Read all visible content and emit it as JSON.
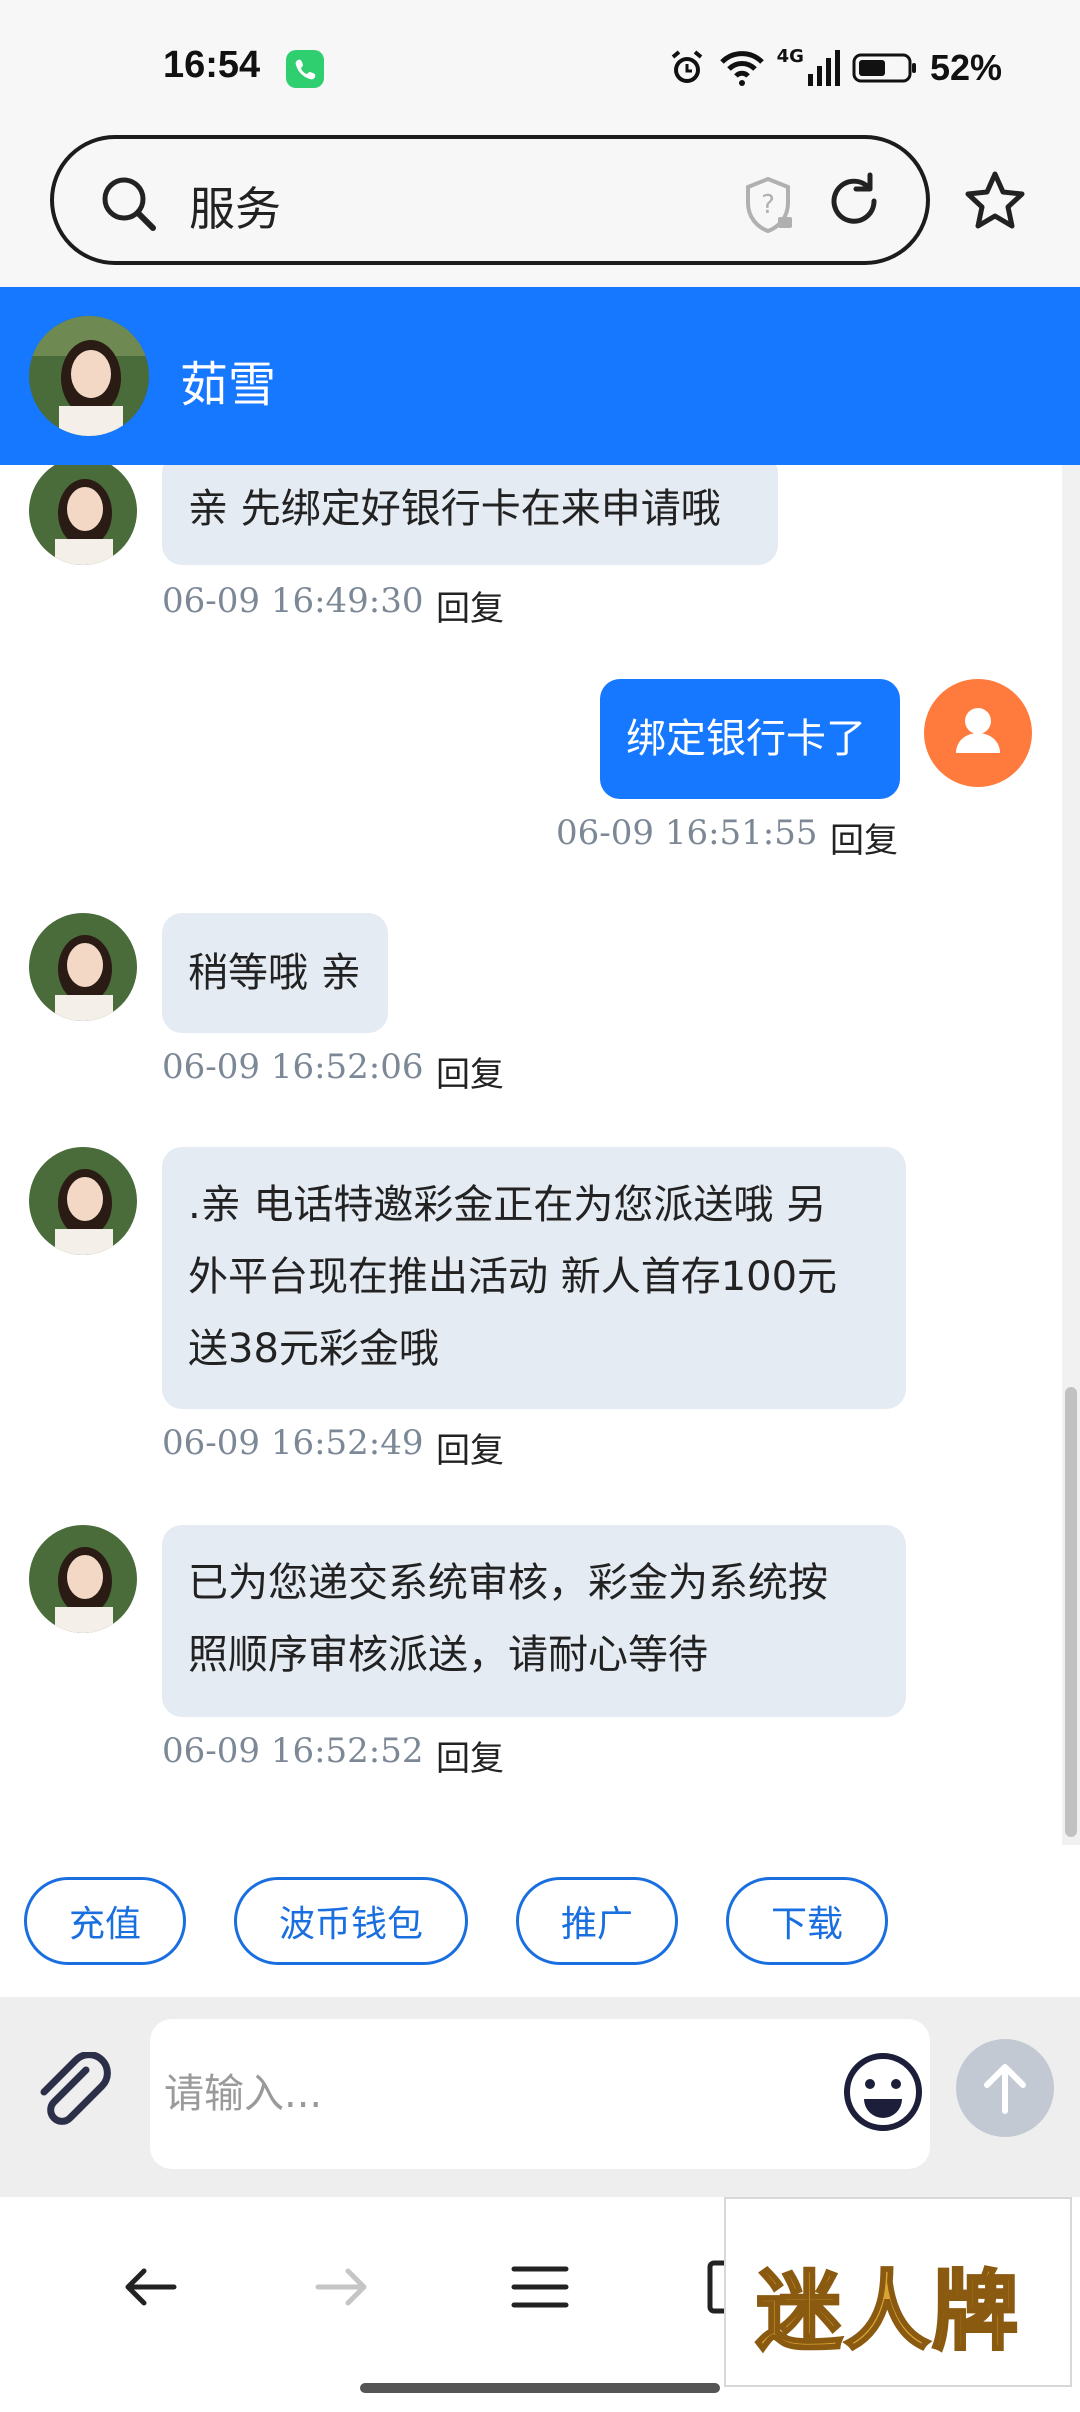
{
  "status_bar": {
    "time": "16:54",
    "battery_text": "52%",
    "network_label": "4G",
    "icons": [
      "phone-call-icon",
      "alarm-icon",
      "wifi-icon",
      "signal-icon",
      "battery-icon"
    ]
  },
  "browser": {
    "url_text": "服务",
    "icons": [
      "search-icon",
      "shield-icon",
      "reload-icon",
      "star-icon"
    ]
  },
  "chat": {
    "contact_name": "茹雪",
    "messages": [
      {
        "side": "left",
        "text_lines": [
          "亲  先绑定好银行卡在来申请哦"
        ],
        "time": "06-09 16:49:30",
        "reply": "回复"
      },
      {
        "side": "right",
        "text_lines": [
          "绑定银行卡了"
        ],
        "time": "06-09 16:51:55",
        "reply": "回复"
      },
      {
        "side": "left",
        "text_lines": [
          "稍等哦 亲"
        ],
        "time": "06-09 16:52:06",
        "reply": "回复"
      },
      {
        "side": "left",
        "text_lines": [
          ".亲 电话特邀彩金正在为您派送哦 另",
          "外平台现在推出活动 新人首存100元",
          "送38元彩金哦"
        ],
        "time": "06-09 16:52:49",
        "reply": "回复"
      },
      {
        "side": "left",
        "text_lines": [
          "已为您递交系统审核，彩金为系统按",
          "照顺序审核派送，请耐心等待"
        ],
        "time": "06-09 16:52:52",
        "reply": "回复"
      }
    ]
  },
  "quick_buttons": [
    "充值",
    "波币钱包",
    "推广",
    "下载"
  ],
  "input": {
    "placeholder": "请输入..."
  },
  "brand_overlay": {
    "text": "迷人牌"
  },
  "colors": {
    "header_blue": "#1677ff",
    "bubble_gray": "#e5ebf3",
    "user_avatar_orange": "#ff7a3d"
  }
}
